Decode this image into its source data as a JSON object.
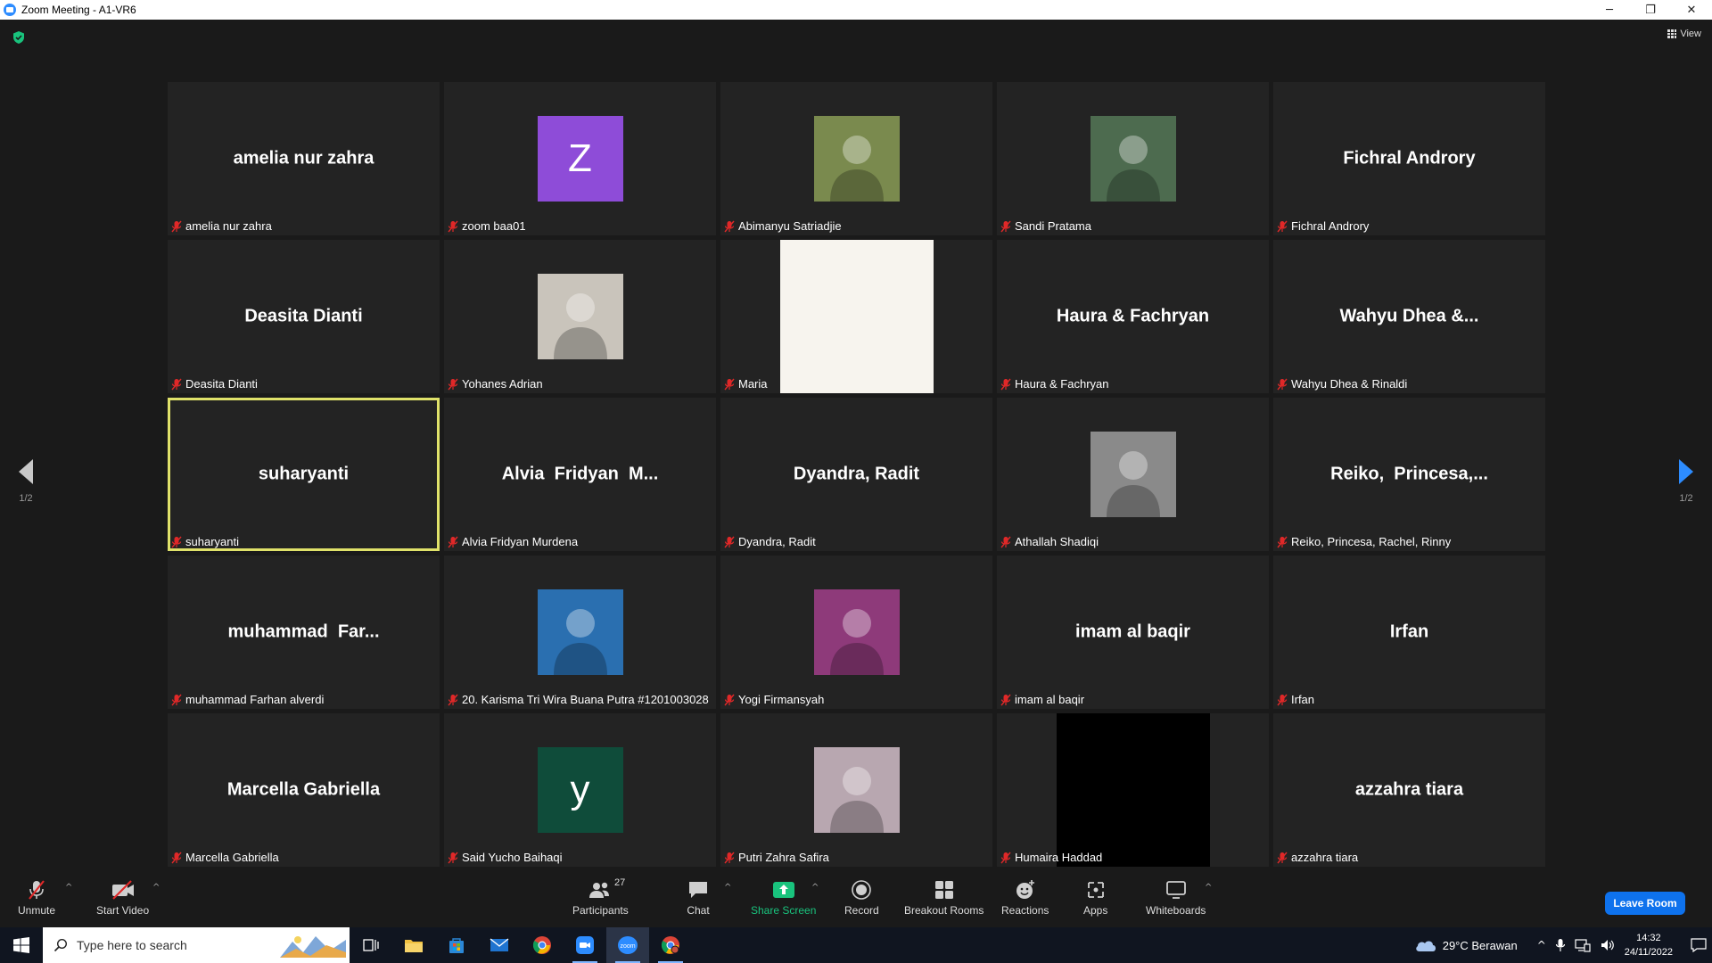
{
  "window": {
    "title": "Zoom Meeting - A1-VR6",
    "minimize": "─",
    "restore": "❐",
    "close": "✕"
  },
  "meeting": {
    "view_label": "View",
    "page_left": "1/2",
    "page_right": "1/2"
  },
  "tiles": [
    {
      "display": "amelia nur zahra",
      "name": "amelia nur zahra",
      "kind": "name"
    },
    {
      "display": "Z",
      "name": "zoom baa01",
      "kind": "letter",
      "color": "#8e4cd8"
    },
    {
      "display": "",
      "name": "Abimanyu Satriadjie",
      "kind": "photo",
      "color": "#7a8a4e"
    },
    {
      "display": "",
      "name": "Sandi Pratama",
      "kind": "photo",
      "color": "#4d6b4f"
    },
    {
      "display": "Fichral Androry",
      "name": "Fichral Androry",
      "kind": "name"
    },
    {
      "display": "Deasita Dianti",
      "name": "Deasita Dianti",
      "kind": "name"
    },
    {
      "display": "",
      "name": "Yohanes Adrian",
      "kind": "photo",
      "color": "#c9c4bb"
    },
    {
      "display": "",
      "name": "Maria",
      "kind": "video",
      "color": "#f7f4ee"
    },
    {
      "display": "Haura & Fachryan",
      "name": "Haura & Fachryan",
      "kind": "name"
    },
    {
      "display": "Wahyu Dhea &...",
      "name": "Wahyu Dhea & Rinaldi",
      "kind": "name"
    },
    {
      "display": "suharyanti",
      "name": "suharyanti",
      "kind": "name",
      "active": true
    },
    {
      "display": "Alvia  Fridyan  M...",
      "name": "Alvia Fridyan Murdena",
      "kind": "name"
    },
    {
      "display": "Dyandra, Radit",
      "name": "Dyandra, Radit",
      "kind": "name"
    },
    {
      "display": "",
      "name": "Athallah Shadiqi",
      "kind": "photo",
      "color": "#8a8a8a"
    },
    {
      "display": "Reiko,  Princesa,...",
      "name": "Reiko, Princesa, Rachel, Rinny",
      "kind": "name"
    },
    {
      "display": "muhammad  Far...",
      "name": "muhammad Farhan alverdi",
      "kind": "name"
    },
    {
      "display": "",
      "name": "20. Karisma Tri Wira Buana Putra #1201003028",
      "kind": "photo",
      "color": "#2a6fb0"
    },
    {
      "display": "",
      "name": "Yogi Firmansyah",
      "kind": "photo",
      "color": "#8e3a7a"
    },
    {
      "display": "imam al baqir",
      "name": "imam al baqir",
      "kind": "name"
    },
    {
      "display": "Irfan",
      "name": "Irfan",
      "kind": "name"
    },
    {
      "display": "Marcella Gabriella",
      "name": "Marcella Gabriella",
      "kind": "name"
    },
    {
      "display": "y",
      "name": "Said Yucho Baihaqi",
      "kind": "letter",
      "color": "#0f4c3a"
    },
    {
      "display": "",
      "name": "Putri Zahra Safira",
      "kind": "photo",
      "color": "#b8a7b0"
    },
    {
      "display": "",
      "name": "Humaira Haddad",
      "kind": "video",
      "color": "#000000"
    },
    {
      "display": "azzahra tiara",
      "name": "azzahra tiara",
      "kind": "name"
    }
  ],
  "toolbar": {
    "unmute": "Unmute",
    "start_video": "Start Video",
    "participants": "Participants",
    "participants_count": "27",
    "chat": "Chat",
    "share_screen": "Share Screen",
    "record": "Record",
    "breakout_rooms": "Breakout Rooms",
    "reactions": "Reactions",
    "apps": "Apps",
    "whiteboards": "Whiteboards",
    "leave": "Leave Room"
  },
  "taskbar": {
    "search_placeholder": "Type here to search",
    "weather": "29°C  Berawan",
    "time": "14:32",
    "date": "24/11/2022"
  },
  "colors": {
    "accent": "#2d8cff",
    "share_green": "#19c37d",
    "leave_blue": "#0e72ed",
    "active_speaker": "#e0e26a",
    "mute_red": "#e02828"
  }
}
